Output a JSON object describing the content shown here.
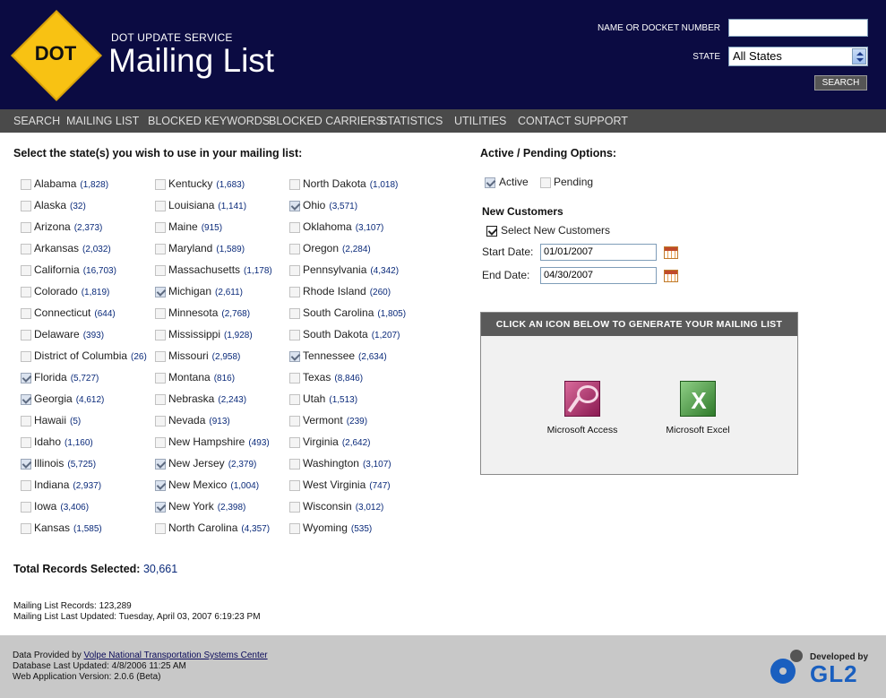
{
  "header": {
    "logo_text": "DOT",
    "service": "DOT UPDATE SERVICE",
    "title": "Mailing List",
    "name_label": "NAME OR DOCKET NUMBER",
    "name_value": "",
    "state_label": "STATE",
    "state_value": "All States",
    "search_label": "SEARCH"
  },
  "nav": [
    "SEARCH",
    "MAILING LIST",
    "BLOCKED KEYWORDS",
    "BLOCKED CARRIERS",
    "STATISTICS",
    "UTILITIES",
    "CONTACT SUPPORT"
  ],
  "states_heading": "Select the state(s) you wish to use in your mailing list:",
  "states": [
    {
      "name": "Alabama",
      "count": "(1,828)",
      "checked": false
    },
    {
      "name": "Alaska",
      "count": "(32)",
      "checked": false
    },
    {
      "name": "Arizona",
      "count": "(2,373)",
      "checked": false
    },
    {
      "name": "Arkansas",
      "count": "(2,032)",
      "checked": false
    },
    {
      "name": "California",
      "count": "(16,703)",
      "checked": false
    },
    {
      "name": "Colorado",
      "count": "(1,819)",
      "checked": false
    },
    {
      "name": "Connecticut",
      "count": "(644)",
      "checked": false
    },
    {
      "name": "Delaware",
      "count": "(393)",
      "checked": false
    },
    {
      "name": "District of Columbia",
      "count": "(26)",
      "checked": false
    },
    {
      "name": "Florida",
      "count": "(5,727)",
      "checked": true
    },
    {
      "name": "Georgia",
      "count": "(4,612)",
      "checked": true
    },
    {
      "name": "Hawaii",
      "count": "(5)",
      "checked": false
    },
    {
      "name": "Idaho",
      "count": "(1,160)",
      "checked": false
    },
    {
      "name": "Illinois",
      "count": "(5,725)",
      "checked": true
    },
    {
      "name": "Indiana",
      "count": "(2,937)",
      "checked": false
    },
    {
      "name": "Iowa",
      "count": "(3,406)",
      "checked": false
    },
    {
      "name": "Kansas",
      "count": "(1,585)",
      "checked": false
    },
    {
      "name": "Kentucky",
      "count": "(1,683)",
      "checked": false
    },
    {
      "name": "Louisiana",
      "count": "(1,141)",
      "checked": false
    },
    {
      "name": "Maine",
      "count": "(915)",
      "checked": false
    },
    {
      "name": "Maryland",
      "count": "(1,589)",
      "checked": false
    },
    {
      "name": "Massachusetts",
      "count": "(1,178)",
      "checked": false
    },
    {
      "name": "Michigan",
      "count": "(2,611)",
      "checked": true
    },
    {
      "name": "Minnesota",
      "count": "(2,768)",
      "checked": false
    },
    {
      "name": "Mississippi",
      "count": "(1,928)",
      "checked": false
    },
    {
      "name": "Missouri",
      "count": "(2,958)",
      "checked": false
    },
    {
      "name": "Montana",
      "count": "(816)",
      "checked": false
    },
    {
      "name": "Nebraska",
      "count": "(2,243)",
      "checked": false
    },
    {
      "name": "Nevada",
      "count": "(913)",
      "checked": false
    },
    {
      "name": "New Hampshire",
      "count": "(493)",
      "checked": false
    },
    {
      "name": "New Jersey",
      "count": "(2,379)",
      "checked": true
    },
    {
      "name": "New Mexico",
      "count": "(1,004)",
      "checked": true
    },
    {
      "name": "New York",
      "count": "(2,398)",
      "checked": true
    },
    {
      "name": "North Carolina",
      "count": "(4,357)",
      "checked": false
    },
    {
      "name": "North Dakota",
      "count": "(1,018)",
      "checked": false
    },
    {
      "name": "Ohio",
      "count": "(3,571)",
      "checked": true
    },
    {
      "name": "Oklahoma",
      "count": "(3,107)",
      "checked": false
    },
    {
      "name": "Oregon",
      "count": "(2,284)",
      "checked": false
    },
    {
      "name": "Pennsylvania",
      "count": "(4,342)",
      "checked": false
    },
    {
      "name": "Rhode Island",
      "count": "(260)",
      "checked": false
    },
    {
      "name": "South Carolina",
      "count": "(1,805)",
      "checked": false
    },
    {
      "name": "South Dakota",
      "count": "(1,207)",
      "checked": false
    },
    {
      "name": "Tennessee",
      "count": "(2,634)",
      "checked": true
    },
    {
      "name": "Texas",
      "count": "(8,846)",
      "checked": false
    },
    {
      "name": "Utah",
      "count": "(1,513)",
      "checked": false
    },
    {
      "name": "Vermont",
      "count": "(239)",
      "checked": false
    },
    {
      "name": "Virginia",
      "count": "(2,642)",
      "checked": false
    },
    {
      "name": "Washington",
      "count": "(3,107)",
      "checked": false
    },
    {
      "name": "West Virginia",
      "count": "(747)",
      "checked": false
    },
    {
      "name": "Wisconsin",
      "count": "(3,012)",
      "checked": false
    },
    {
      "name": "Wyoming",
      "count": "(535)",
      "checked": false
    }
  ],
  "total": {
    "label": "Total Records Selected:",
    "value": "30,661"
  },
  "meta": {
    "records": "Mailing List Records: 123,289",
    "updated": "Mailing List Last Updated: Tuesday, April 03, 2007 6:19:23 PM"
  },
  "options": {
    "heading": "Active / Pending Options:",
    "active_label": "Active",
    "active_checked": true,
    "pending_label": "Pending",
    "pending_checked": false,
    "new_customers_heading": "New Customers",
    "select_new_label": "Select New Customers",
    "select_new_checked": true,
    "start_label": "Start Date:",
    "start_value": "01/01/2007",
    "end_label": "End Date:",
    "end_value": "04/30/2007"
  },
  "generate": {
    "heading": "CLICK AN ICON BELOW TO GENERATE YOUR MAILING LIST",
    "access_label": "Microsoft Access",
    "excel_label": "Microsoft Excel",
    "excel_glyph": "X"
  },
  "footer": {
    "provided_prefix": "Data Provided by",
    "provided_link": "Volpe National Transportation Systems Center",
    "db_updated": "Database Last Updated: 4/8/2006 11:25 AM",
    "version": "Web Application Version: 2.0.6 (Beta)",
    "developed_by": "Developed by",
    "developer": "GL2"
  },
  "colors": {
    "header_bg": "#0b0b42",
    "nav_bg": "#4a4a4a",
    "logo": "#f8c213",
    "count_text": "#0a2a7a",
    "footer_bg": "#c8c8c8",
    "brand_blue": "#1a5fbf"
  },
  "icons": [
    "dot-logo",
    "select-arrow-icon",
    "calendar-icon",
    "access-icon",
    "excel-icon",
    "gl2-gear-icon"
  ]
}
